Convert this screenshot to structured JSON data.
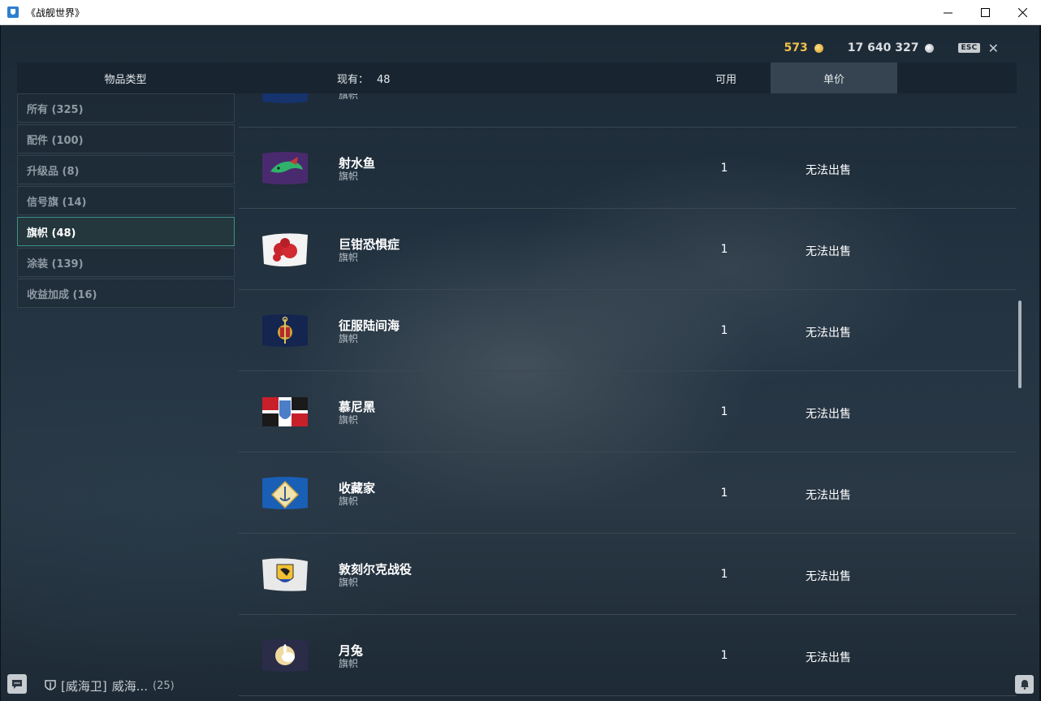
{
  "window": {
    "title": "《战舰世界》",
    "minimize": "—",
    "maximize": "☐",
    "close": "✕"
  },
  "currency": {
    "gold": "573",
    "credits": "17 640 327",
    "esc": "ESC",
    "esc_close": "✕"
  },
  "header": {
    "item_type": "物品类型",
    "have_label": "现有：",
    "have_count": "48",
    "available": "可用",
    "unit_price": "单价"
  },
  "categories": [
    {
      "label": "所有 (325)"
    },
    {
      "label": "配件 (100)"
    },
    {
      "label": "升级品 (8)"
    },
    {
      "label": "信号旗 (14)"
    },
    {
      "label": "旗帜 (48)"
    },
    {
      "label": "涂装 (139)"
    },
    {
      "label": "收益加成 (16)"
    }
  ],
  "active_category": "旗帜 (48)",
  "items": [
    {
      "name": "",
      "type": "旗帜",
      "qty": "",
      "price": "",
      "flag": "navy-shield-flag-icon"
    },
    {
      "name": "射水鱼",
      "type": "旗帜",
      "qty": "1",
      "price": "无法出售",
      "flag": "archerfish-flag-icon"
    },
    {
      "name": "巨钳恐惧症",
      "type": "旗帜",
      "qty": "1",
      "price": "无法出售",
      "flag": "crab-flag-icon"
    },
    {
      "name": "征服陆间海",
      "type": "旗帜",
      "qty": "1",
      "price": "无法出售",
      "flag": "anchor-flag-icon"
    },
    {
      "name": "慕尼黑",
      "type": "旗帜",
      "qty": "1",
      "price": "无法出售",
      "flag": "munich-flag-icon"
    },
    {
      "name": "收藏家",
      "type": "旗帜",
      "qty": "1",
      "price": "无法出售",
      "flag": "collector-flag-icon"
    },
    {
      "name": "敦刻尔克战役",
      "type": "旗帜",
      "qty": "1",
      "price": "无法出售",
      "flag": "dunkirk-flag-icon"
    },
    {
      "name": "月兔",
      "type": "旗帜",
      "qty": "1",
      "price": "无法出售",
      "flag": "moon-rabbit-flag-icon"
    }
  ],
  "footer": {
    "clan_tag": "[威海卫]",
    "clan_name": "威海...",
    "clan_count": "(25)"
  }
}
